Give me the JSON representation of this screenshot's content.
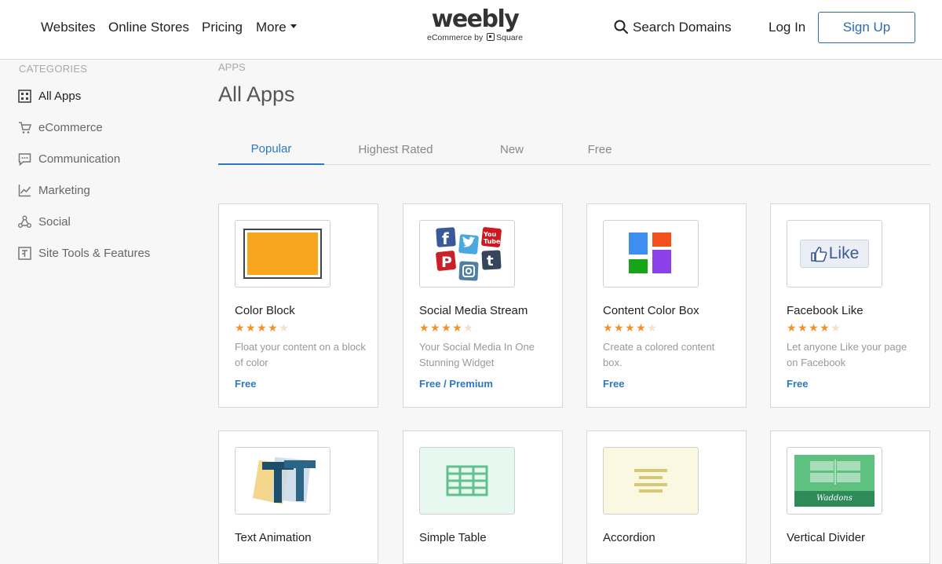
{
  "header": {
    "nav": [
      "Websites",
      "Online Stores",
      "Pricing"
    ],
    "more": "More",
    "logo": "weebly",
    "logo_sub_prefix": "eCommerce by",
    "logo_sub_brand": "Square",
    "search_domains": "Search Domains",
    "login": "Log In",
    "signup": "Sign Up"
  },
  "sidebar": {
    "title": "CATEGORIES",
    "items": [
      {
        "label": "All Apps",
        "icon": "grid-icon",
        "active": true
      },
      {
        "label": "eCommerce",
        "icon": "cart-icon"
      },
      {
        "label": "Communication",
        "icon": "chat-icon"
      },
      {
        "label": "Marketing",
        "icon": "chart-icon"
      },
      {
        "label": "Social",
        "icon": "share-icon"
      },
      {
        "label": "Site Tools & Features",
        "icon": "tools-icon"
      }
    ]
  },
  "main": {
    "breadcrumb": "APPS",
    "title": "All Apps",
    "tabs": [
      {
        "label": "Popular",
        "active": true
      },
      {
        "label": "Highest Rated"
      },
      {
        "label": "New"
      },
      {
        "label": "Free"
      }
    ]
  },
  "apps": [
    {
      "name": "Color Block",
      "rating": 4,
      "desc": "Float your content on a block of color",
      "price": "Free",
      "icon": "color-block-icon"
    },
    {
      "name": "Social Media Stream",
      "rating": 4,
      "desc": "Your Social Media In One Stunning Widget",
      "price": "Free / Premium",
      "icon": "social-media-icon"
    },
    {
      "name": "Content Color Box",
      "rating": 4,
      "desc": "Create a colored content box.",
      "price": "Free",
      "icon": "color-box-icon"
    },
    {
      "name": "Facebook Like",
      "rating": 4,
      "desc": "Let anyone Like your page on Facebook",
      "price": "Free",
      "icon": "facebook-like-icon",
      "icon_text": "Like"
    },
    {
      "name": "Text Animation",
      "icon": "text-animation-icon"
    },
    {
      "name": "Simple Table",
      "icon": "table-icon"
    },
    {
      "name": "Accordion",
      "icon": "accordion-icon"
    },
    {
      "name": "Vertical Divider",
      "icon": "vertical-divider-icon",
      "icon_text": "Waddons"
    }
  ],
  "colors": {
    "accent": "#2b78c2",
    "star": "#f0932b",
    "star_empty": "#f5dfc6"
  }
}
